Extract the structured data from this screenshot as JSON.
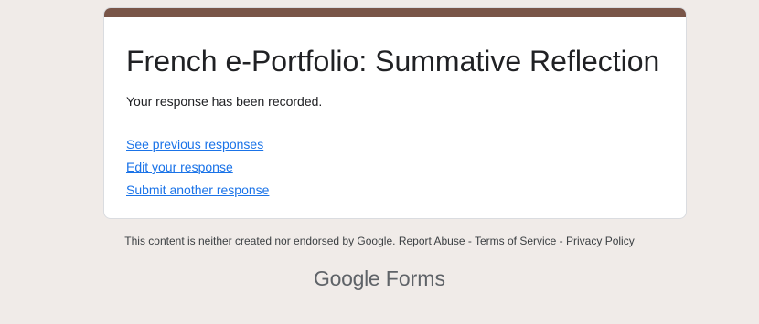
{
  "form": {
    "title": "French e-Portfolio: Summative Reflection",
    "confirmation": "Your response has been recorded.",
    "links": {
      "see_previous": "See previous responses",
      "edit_response": "Edit your response",
      "submit_another": "Submit another response"
    }
  },
  "footer": {
    "disclaimer": "This content is neither created nor endorsed by Google.",
    "report_abuse": "Report Abuse",
    "separator": " - ",
    "terms": "Terms of Service",
    "privacy": "Privacy Policy"
  },
  "brand": {
    "logo_text": "Google",
    "product": "Forms"
  },
  "colors": {
    "theme_band": "#795548",
    "background": "#f0ebe8",
    "link": "#1a73e8"
  }
}
